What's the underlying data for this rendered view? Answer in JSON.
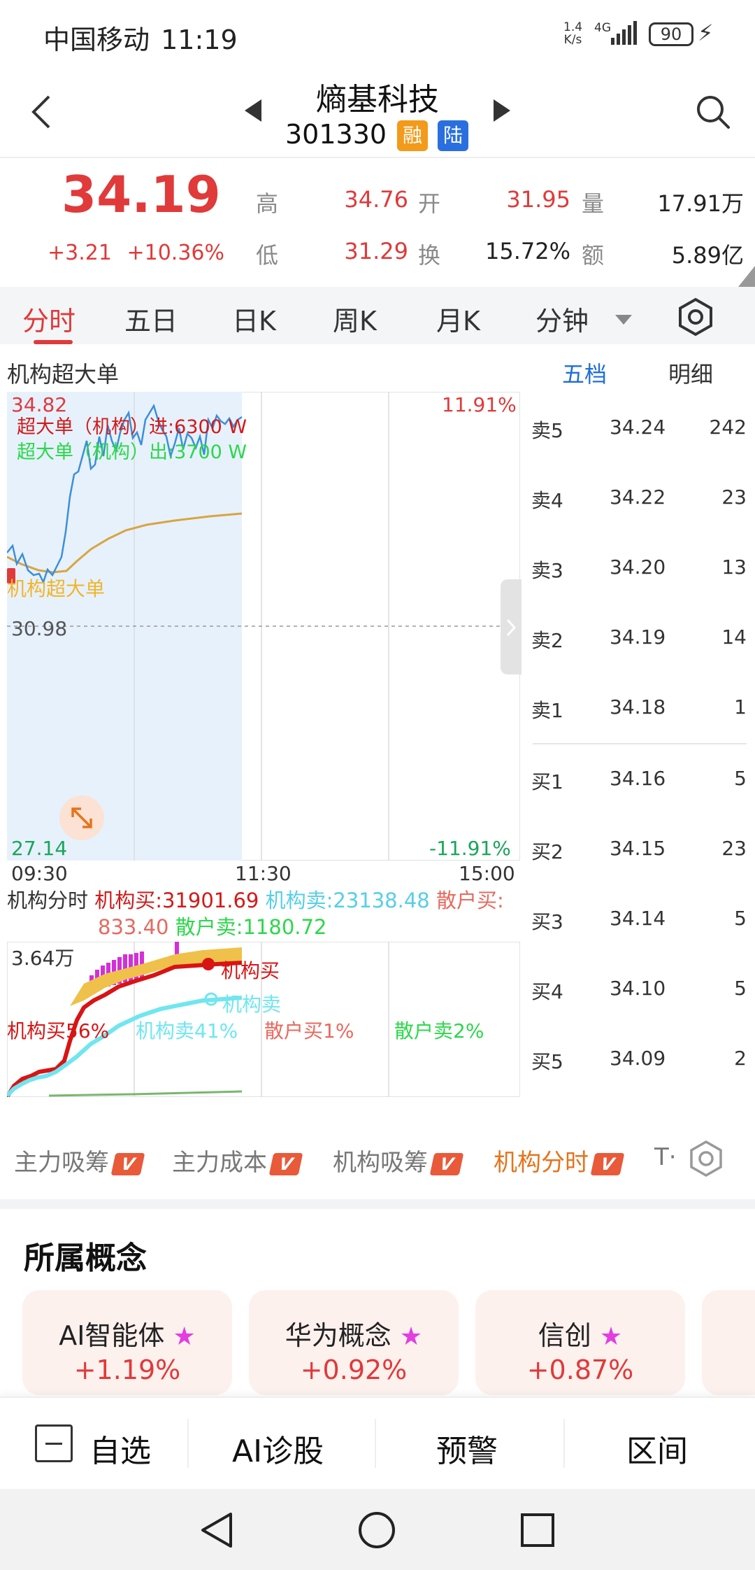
{
  "status_bar": {
    "carrier": "中国移动",
    "time": "11:19",
    "net_speed_value": "1.4",
    "net_speed_unit": "K/s",
    "signal": "4G",
    "battery": "90"
  },
  "header": {
    "stock_name": "熵基科技",
    "stock_code": "301330",
    "tag_margin": "融",
    "tag_connect": "陆"
  },
  "quote": {
    "price": "34.19",
    "change": "+3.21",
    "change_pct": "+10.36%",
    "high_label": "高",
    "high": "34.76",
    "open_label": "开",
    "open": "31.95",
    "volume_label": "量",
    "volume": "17.91万",
    "low_label": "低",
    "low": "31.29",
    "turnover_label": "换",
    "turnover": "15.72%",
    "amount_label": "额",
    "amount": "5.89亿"
  },
  "tabs": [
    "分时",
    "五日",
    "日K",
    "周K",
    "月K",
    "分钟"
  ],
  "active_tab": "分时",
  "chart": {
    "title": "机构超大单",
    "y_top": "34.82",
    "y_mid": "30.98",
    "y_bottom": "27.14",
    "pct_top": "11.91%",
    "pct_bottom": "-11.91%",
    "time_start": "09:30",
    "time_mid": "11:30",
    "time_end": "15:00",
    "legend_in": "超大单（机构）进:6300 W",
    "legend_out": "超大单（机构）出:3700 W",
    "marker_label": "机构超大单"
  },
  "orderbook_tabs": [
    "五档",
    "明细"
  ],
  "orderbook": {
    "asks": [
      {
        "label": "卖5",
        "price": "34.24",
        "vol": "242"
      },
      {
        "label": "卖4",
        "price": "34.22",
        "vol": "23"
      },
      {
        "label": "卖3",
        "price": "34.20",
        "vol": "13"
      },
      {
        "label": "卖2",
        "price": "34.19",
        "vol": "14"
      },
      {
        "label": "卖1",
        "price": "34.18",
        "vol": "1"
      }
    ],
    "bids": [
      {
        "label": "买1",
        "price": "34.16",
        "vol": "5"
      },
      {
        "label": "买2",
        "price": "34.15",
        "vol": "23"
      },
      {
        "label": "买3",
        "price": "34.14",
        "vol": "5"
      },
      {
        "label": "买4",
        "price": "34.10",
        "vol": "5"
      },
      {
        "label": "买5",
        "price": "34.09",
        "vol": "2"
      }
    ]
  },
  "flow": {
    "title": "机构分时",
    "inst_buy": "机构买:31901.69",
    "inst_sell": "机构卖:23138.48",
    "retail_buy_label": "散户买:",
    "retail_buy_value": "833.40",
    "retail_sell": "散户卖:1180.72",
    "y_max": "3.64万",
    "legend_inst_buy": "机构买",
    "legend_inst_sell": "机构卖",
    "pct_inst_buy": "机构买56%",
    "pct_inst_sell": "机构卖41%",
    "pct_retail_buy": "散户买1%",
    "pct_retail_sell": "散户卖2%"
  },
  "indicators": [
    {
      "label": "主力吸筹",
      "badge": "V"
    },
    {
      "label": "主力成本",
      "badge": "V"
    },
    {
      "label": "机构吸筹",
      "badge": "V"
    },
    {
      "label": "机构分时",
      "badge": "V"
    }
  ],
  "indicator_more": "T·",
  "concepts": {
    "title": "所属概念",
    "items": [
      {
        "name": "AI智能体",
        "pct": "+1.19%"
      },
      {
        "name": "华为概念",
        "pct": "+0.92%"
      },
      {
        "name": "信创",
        "pct": "+0.87%"
      }
    ]
  },
  "bottom_bar": {
    "watchlist": "自选",
    "ai_diag": "AI诊股",
    "alert": "预警",
    "range": "区间"
  },
  "colors": {
    "up_red": "#e03a3a",
    "down_green": "#18a65a",
    "accent_blue": "#1e6fd6",
    "accent_orange": "#e5741c",
    "price_line": "#3b8fd9",
    "avg_line": "#d9a441",
    "inst_sell_cyan": "#6fe6f0"
  }
}
